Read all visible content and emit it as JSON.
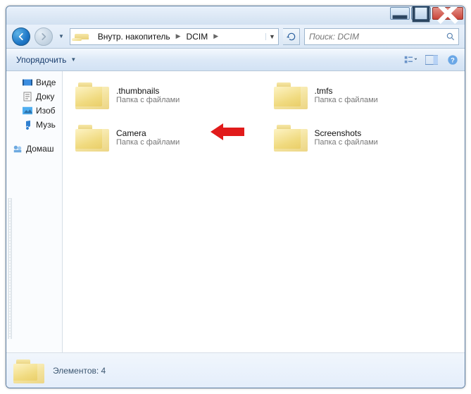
{
  "breadcrumb": {
    "prefix_glyph": "«",
    "items": [
      "Внутр. накопитель",
      "DCIM"
    ]
  },
  "search": {
    "placeholder": "Поиск: DCIM"
  },
  "toolbar": {
    "organize": "Упорядочить"
  },
  "sidebar": {
    "items": [
      {
        "icon": "video",
        "label": "Виде"
      },
      {
        "icon": "doc",
        "label": "Доку"
      },
      {
        "icon": "image",
        "label": "Изоб"
      },
      {
        "icon": "music",
        "label": "Музь"
      }
    ],
    "home": {
      "label": "Домаш"
    }
  },
  "folders": [
    {
      "name": ".thumbnails",
      "sub": "Папка с файлами"
    },
    {
      "name": ".tmfs",
      "sub": "Папка с файлами"
    },
    {
      "name": "Camera",
      "sub": "Папка с файлами",
      "highlight": true
    },
    {
      "name": "Screenshots",
      "sub": "Папка с файлами"
    }
  ],
  "status": {
    "count_label": "Элементов: 4"
  }
}
